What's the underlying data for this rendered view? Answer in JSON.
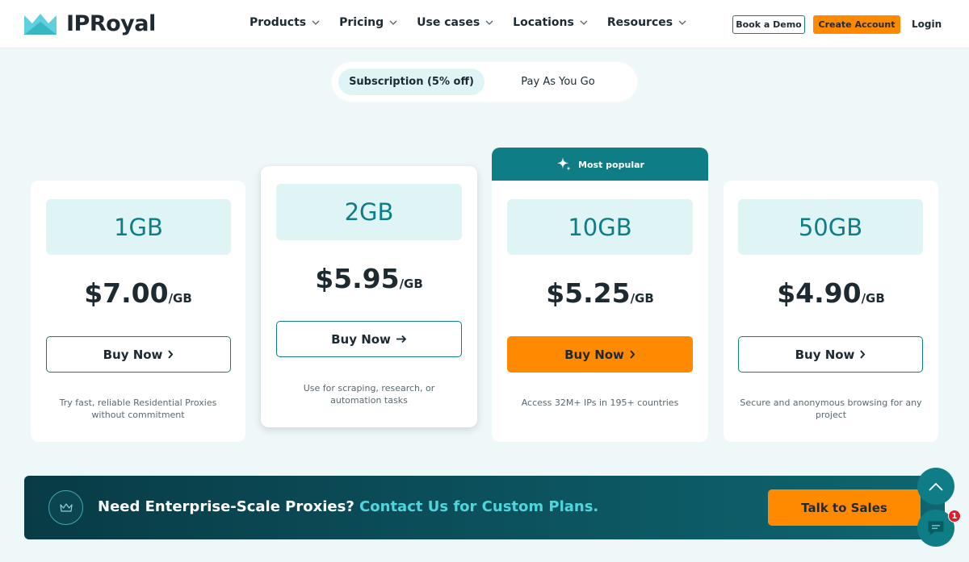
{
  "header": {
    "brand": "IPRoyal",
    "nav": [
      {
        "label": "Products"
      },
      {
        "label": "Pricing"
      },
      {
        "label": "Use cases"
      },
      {
        "label": "Locations"
      },
      {
        "label": "Resources"
      }
    ],
    "book_demo": "Book a Demo",
    "create_account": "Create Account",
    "login": "Login"
  },
  "billing_toggle": {
    "active": "Subscription (5% off)",
    "inactive": "Pay As You Go"
  },
  "plans": [
    {
      "size": "1GB",
      "price": "$7.00",
      "unit": "/GB",
      "cta": "Buy Now",
      "description": "Try fast, reliable Residential Proxies without commitment"
    },
    {
      "size": "2GB",
      "price": "$5.95",
      "unit": "/GB",
      "cta": "Buy Now",
      "description": "Use for scraping, research, or automation tasks"
    },
    {
      "size": "10GB",
      "price": "$5.25",
      "unit": "/GB",
      "cta": "Buy Now",
      "description": "Access 32M+ IPs in 195+ countries",
      "badge": "Most popular"
    },
    {
      "size": "50GB",
      "price": "$4.90",
      "unit": "/GB",
      "cta": "Buy Now",
      "description": "Secure and anonymous browsing for any project"
    }
  ],
  "banner": {
    "text": "Need Enterprise-Scale Proxies?",
    "accent": "Contact Us for Custom Plans.",
    "cta": "Talk to Sales"
  },
  "chat": {
    "badge_count": "1"
  },
  "colors": {
    "teal": "#0f7d86",
    "orange": "#ff8a00",
    "light_teal": "#dff4f5"
  }
}
